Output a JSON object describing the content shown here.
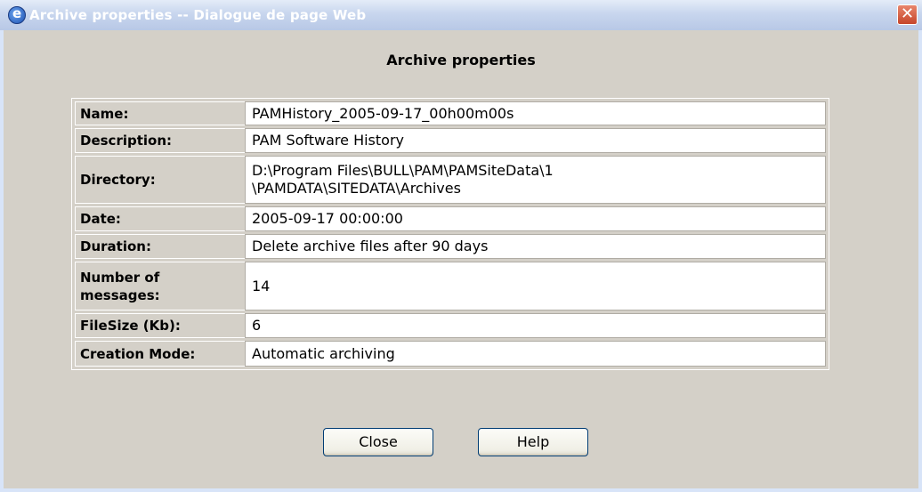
{
  "window": {
    "title": "Archive properties -- Dialogue de page Web",
    "icon": "ie-icon",
    "close_glyph": "✕"
  },
  "heading": "Archive properties",
  "properties": [
    {
      "label": "Name:",
      "value": "PAMHistory_2005-09-17_00h00m00s"
    },
    {
      "label": "Description:",
      "value": "PAM Software History"
    },
    {
      "label": "Directory:",
      "value": "D:\\Program Files\\BULL\\PAM\\PAMSiteData\\1\n\\PAMDATA\\SITEDATA\\Archives"
    },
    {
      "label": "Date:",
      "value": "2005-09-17 00:00:00"
    },
    {
      "label": "Duration:",
      "value": "Delete archive files after 90 days"
    },
    {
      "label": "Number of\nmessages:",
      "value": "14"
    },
    {
      "label": "FileSize (Kb):",
      "value": "6"
    },
    {
      "label": "Creation Mode:",
      "value": "Automatic archiving"
    }
  ],
  "buttons": {
    "close_label": "Close",
    "help_label": "Help"
  }
}
